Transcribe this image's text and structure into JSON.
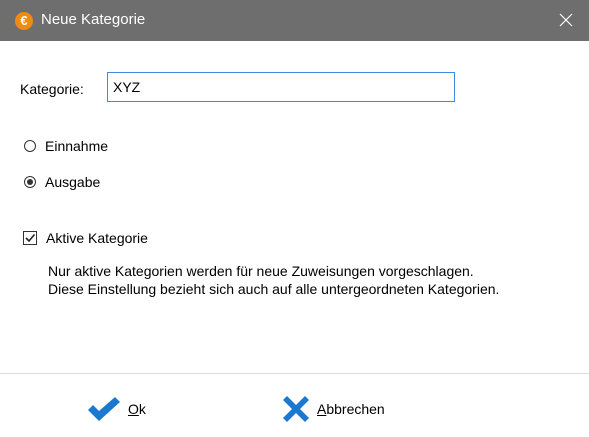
{
  "window": {
    "title": "Neue Kategorie",
    "app_icon_glyph": "€"
  },
  "form": {
    "kategorie_label": "Kategorie:",
    "kategorie_value": "XYZ",
    "type_options": [
      {
        "label": "Einnahme",
        "checked": false
      },
      {
        "label": "Ausgabe",
        "checked": true
      }
    ],
    "active_checkbox": {
      "label": "Aktive Kategorie",
      "checked": true
    },
    "hint_lines": [
      "Nur aktive Kategorien werden für neue Zuweisungen vorgeschlagen.",
      "Diese Einstellung bezieht sich auch auf alle untergeordneten Kategorien."
    ]
  },
  "buttons": {
    "ok_mnemonic": "O",
    "ok_rest": "k",
    "cancel_mnemonic": "A",
    "cancel_rest": "bbrechen"
  },
  "colors": {
    "titlebar": "#6e6e6e",
    "app_icon": "#f08a12",
    "accent_blue": "#1b78d0",
    "input_border": "#3c8ce0"
  },
  "icons": {
    "app": "euro-icon",
    "close": "close-icon",
    "ok": "checkmark-icon",
    "cancel": "cross-icon"
  }
}
